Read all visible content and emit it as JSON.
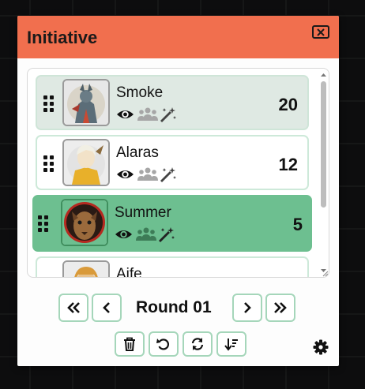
{
  "window": {
    "title": "Initiative",
    "close_icon": "close-icon"
  },
  "combatants": [
    {
      "name": "Smoke",
      "initiative": "20",
      "state": "first"
    },
    {
      "name": "Alaras",
      "initiative": "12",
      "state": "normal"
    },
    {
      "name": "Summer",
      "initiative": "5",
      "state": "active"
    },
    {
      "name": "Aife",
      "initiative": "",
      "state": "normal"
    }
  ],
  "row_icons": [
    "eye-icon",
    "users-icon",
    "magic-wand-icon"
  ],
  "navigation": {
    "round_label": "Round 01",
    "buttons": [
      "double-chevron-left-icon",
      "chevron-left-icon",
      "chevron-right-icon",
      "double-chevron-right-icon"
    ]
  },
  "tools": [
    "trash-icon",
    "undo-icon",
    "sync-icon",
    "sort-descending-icon"
  ],
  "settings_icon": "gear-icon",
  "colors": {
    "header": "#f16f4e",
    "active_row": "#6dbf90",
    "first_row": "#dfe9e3",
    "button_border": "#a5d6ba"
  }
}
